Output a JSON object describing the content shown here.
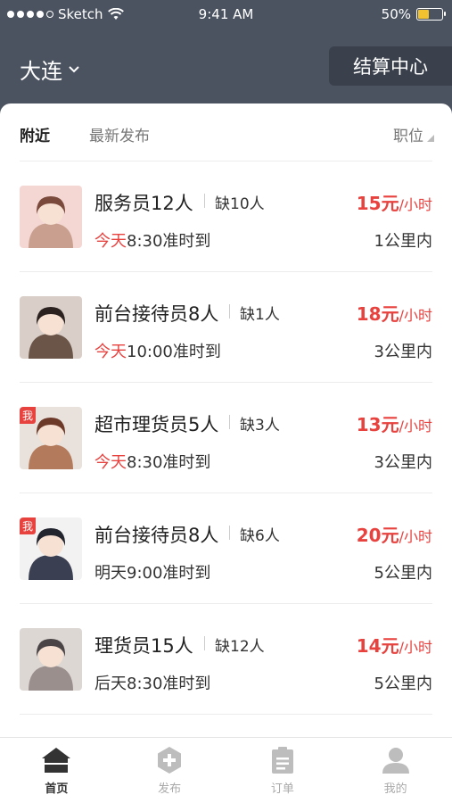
{
  "status_bar": {
    "carrier": "Sketch",
    "time": "9:41 AM",
    "battery": "50%",
    "battery_level": 0.5
  },
  "header": {
    "city": "大连",
    "settle_button": "结算中心"
  },
  "filters": {
    "nearby": "附近",
    "latest": "最新发布",
    "position": "职位"
  },
  "jobs": [
    {
      "title": "服务员12人",
      "need": "缺10人",
      "day": "今天",
      "time": "8:30准时到",
      "day_highlight": true,
      "pay": "15元",
      "unit": "/小时",
      "distance": "1公里内",
      "mine": false
    },
    {
      "title": "前台接待员8人",
      "need": "缺1人",
      "day": "今天",
      "time": "10:00准时到",
      "day_highlight": true,
      "pay": "18元",
      "unit": "/小时",
      "distance": "3公里内",
      "mine": false
    },
    {
      "title": "超市理货员5人",
      "need": "缺3人",
      "day": "今天",
      "time": "8:30准时到",
      "day_highlight": true,
      "pay": "13元",
      "unit": "/小时",
      "distance": "3公里内",
      "mine": true,
      "badge": "我"
    },
    {
      "title": "前台接待员8人",
      "need": "缺6人",
      "day": "明天",
      "time": "9:00准时到",
      "day_highlight": false,
      "pay": "20元",
      "unit": "/小时",
      "distance": "5公里内",
      "mine": true,
      "badge": "我"
    },
    {
      "title": "理货员15人",
      "need": "缺12人",
      "day": "后天",
      "time": "8:30准时到",
      "day_highlight": false,
      "pay": "14元",
      "unit": "/小时",
      "distance": "5公里内",
      "mine": false
    }
  ],
  "nav": {
    "home": "首页",
    "publish": "发布",
    "orders": "订单",
    "mine": "我的"
  },
  "colors": {
    "accent": "#e8423f",
    "header_bg": "#4b5361"
  }
}
